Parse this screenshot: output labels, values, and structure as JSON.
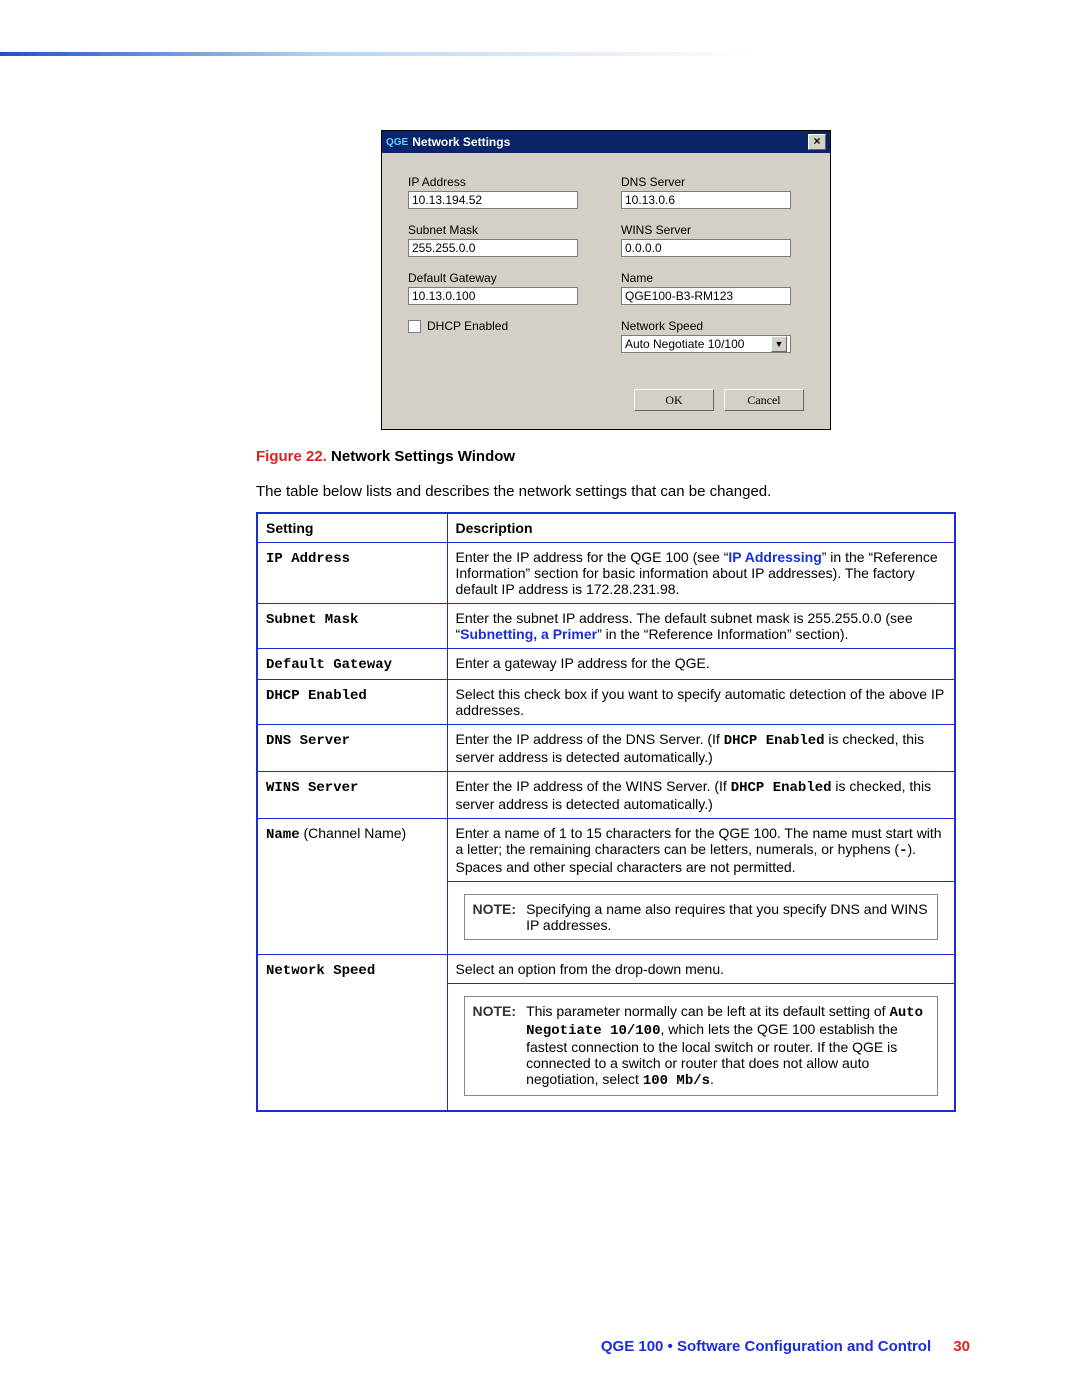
{
  "dialog": {
    "title_prefix": "QGE",
    "title": "Network Settings",
    "fields": {
      "ip_address_label": "IP Address",
      "ip_address_value": "10.13.194.52",
      "subnet_mask_label": "Subnet Mask",
      "subnet_mask_value": "255.255.0.0",
      "default_gateway_label": "Default Gateway",
      "default_gateway_value": "10.13.0.100",
      "dhcp_label": "DHCP Enabled",
      "dns_server_label": "DNS Server",
      "dns_server_value": "10.13.0.6",
      "wins_server_label": "WINS Server",
      "wins_server_value": "0.0.0.0",
      "name_label": "Name",
      "name_value": "QGE100-B3-RM123",
      "network_speed_label": "Network Speed",
      "network_speed_value": "Auto Negotiate 10/100"
    },
    "buttons": {
      "ok": "OK",
      "cancel": "Cancel"
    }
  },
  "figure": {
    "prefix": "Figure 22.",
    "caption": "Network Settings Window"
  },
  "intro": "The table below lists and describes the network settings that can be changed.",
  "table": {
    "headers": {
      "setting": "Setting",
      "description": "Description"
    },
    "rows": {
      "ip_address": {
        "name": "IP Address",
        "desc_pre": "Enter the IP address for the QGE 100 (see “",
        "link": "IP Addressing",
        "desc_post": "” in the “Reference Information” section for basic information about IP addresses). The factory default IP address is 172.28.231.98."
      },
      "subnet_mask": {
        "name": "Subnet Mask",
        "desc_pre": "Enter the subnet IP address. The default subnet mask is 255.255.0.0 (see “",
        "link": "Subnetting, a Primer",
        "desc_post": "” in the “Reference Information” section)."
      },
      "default_gateway": {
        "name": "Default Gateway",
        "desc": "Enter a gateway IP address for the QGE."
      },
      "dhcp_enabled": {
        "name": "DHCP Enabled",
        "desc": "Select this check box if you want to specify automatic detection of the above IP addresses."
      },
      "dns_server": {
        "name": "DNS Server",
        "desc_pre": "Enter the IP address of the DNS Server. (If ",
        "mono": "DHCP Enabled",
        "desc_post": " is checked, this server address is detected automatically.)"
      },
      "wins_server": {
        "name": "WINS Server",
        "desc_pre": "Enter the IP address of the WINS Server. (If ",
        "mono": "DHCP Enabled",
        "desc_post": " is checked, this server address is detected automatically.)"
      },
      "name": {
        "name": "Name",
        "paren": " (Channel Name)",
        "desc_pre": "Enter a name of 1 to 15 characters for the QGE 100. The name must start with a letter; the remaining characters can be letters, numerals, or hyphens (",
        "mono": "-",
        "desc_post": "). Spaces and other special characters are not permitted.",
        "note_label": "NOTE:",
        "note_text": "Specifying a name also requires that you specify DNS and WINS IP addresses."
      },
      "network_speed": {
        "name": "Network Speed",
        "desc": "Select an option from the drop-down menu.",
        "note_label": "NOTE:",
        "note_pre": "This parameter normally can be left at its default setting of ",
        "mono1": "Auto Negotiate 10/100",
        "note_mid": ", which lets the QGE 100 establish the fastest connection to the local switch or router. If the QGE is connected to a switch or router that does not allow auto negotiation, select ",
        "mono2": "100 Mb/s",
        "note_post": "."
      }
    }
  },
  "footer": {
    "text": "QGE 100 • Software Configuration and Control",
    "page": "30"
  }
}
